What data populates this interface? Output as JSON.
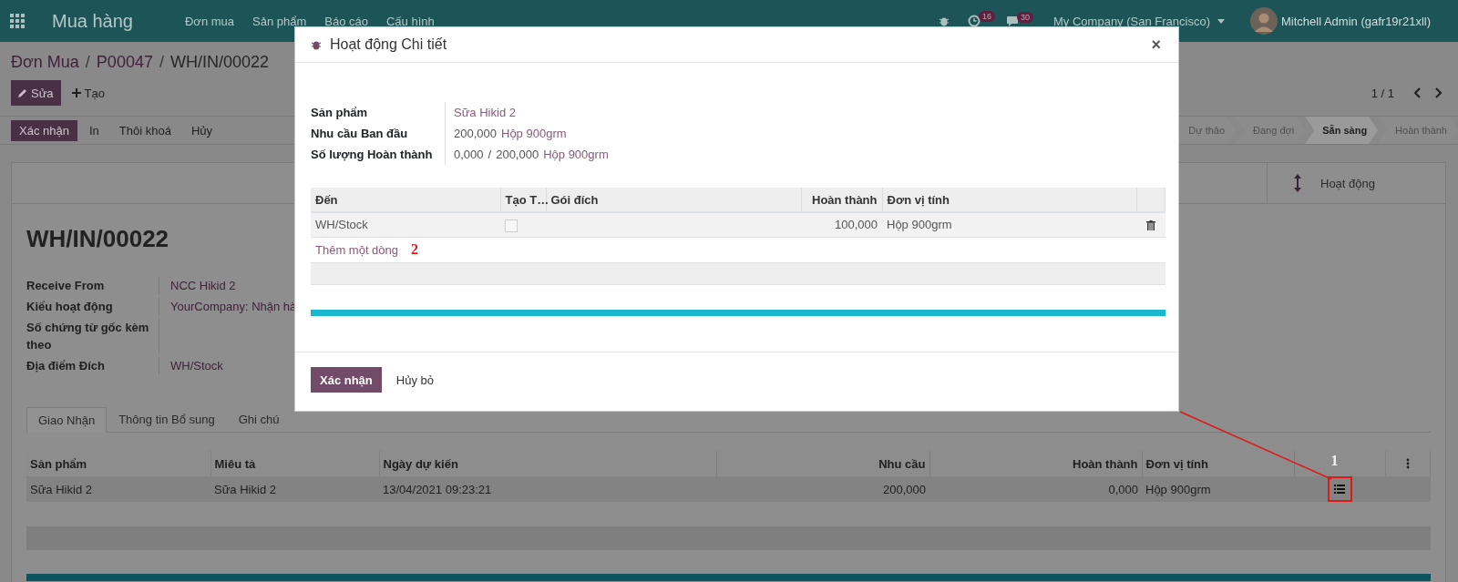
{
  "top_bar": {
    "app_title": "Mua hàng",
    "menu": [
      "Đơn mua",
      "Sản phẩm",
      "Báo cáo",
      "Cấu hình"
    ],
    "activity_count": "16",
    "message_count": "30",
    "company": "My Company (San Francisco)",
    "user": "Mitchell Admin (gafr19r21xll)"
  },
  "breadcrumbs": {
    "separator": "/",
    "items": [
      {
        "label": "Đơn Mua",
        "link": true
      },
      {
        "label": "P00047",
        "link": true
      },
      {
        "label": "WH/IN/00022",
        "link": false
      }
    ]
  },
  "actions": [
    {
      "label": "Sửa",
      "kind": "primary"
    },
    {
      "label": "Tạo",
      "kind": "plain"
    }
  ],
  "pager": "1 / 1",
  "workflow_buttons": [
    {
      "label": "Xác nhận",
      "kind": "primary"
    },
    {
      "label": "In",
      "kind": "plain"
    },
    {
      "label": "Thôi khoá",
      "kind": "plain"
    },
    {
      "label": "Hủy",
      "kind": "plain"
    }
  ],
  "status_steps": [
    {
      "label": "Dự thảo",
      "selected": false
    },
    {
      "label": "Đang đợi",
      "selected": false
    },
    {
      "label": "Sẵn sàng",
      "selected": true
    },
    {
      "label": "Hoàn thành",
      "selected": false
    }
  ],
  "smart_button": {
    "label": "Hoạt động"
  },
  "record": {
    "title": "WH/IN/00022",
    "fields": [
      {
        "label": "Receive From",
        "value": "NCC Hikid 2",
        "link": true
      },
      {
        "label": "Kiểu hoạt động",
        "value": "YourCompany: Nhận hà",
        "link": true
      },
      {
        "label": "Số chứng từ gốc kèm theo"
      },
      {
        "label": "Địa điểm Đích",
        "value": "WH/Stock",
        "link": true
      }
    ]
  },
  "tabs": [
    {
      "label": "Giao Nhận",
      "selected": true
    },
    {
      "label": "Thông tin Bổ sung",
      "selected": false
    },
    {
      "label": "Ghi chú",
      "selected": false
    }
  ],
  "moves_table": {
    "columns": [
      {
        "label": "Sản phẩm",
        "numeric": false
      },
      {
        "label": "Miêu tả",
        "numeric": false
      },
      {
        "label": "Ngày dự kiến",
        "numeric": false
      },
      {
        "label": "Nhu cầu",
        "numeric": true
      },
      {
        "label": "Hoàn thành",
        "numeric": true
      },
      {
        "label": "Đơn vị tính",
        "numeric": false
      }
    ],
    "marker": "1",
    "rows": [
      {
        "cells": [
          "Sữa Hikid 2",
          "Sữa Hikid 2",
          "13/04/2021 09:23:21",
          "200,000",
          "0,000",
          "Hộp 900grm"
        ],
        "icon_highlighted": true
      }
    ]
  },
  "dialog": {
    "title": "Hoạt động Chi tiết",
    "close": "×",
    "info": [
      {
        "label": "Sản phẩm",
        "parts": [
          {
            "text": "Sữa Hikid 2",
            "link": true
          }
        ]
      },
      {
        "label": "Nhu cầu Ban đầu",
        "parts": [
          {
            "text": "200,000",
            "link": false
          },
          {
            "text": "Hộp 900grm",
            "link": true
          }
        ]
      },
      {
        "label": "Số lượng Hoàn thành",
        "parts": [
          {
            "text": "0,000",
            "link": false
          },
          {
            "text": "/",
            "link": false
          },
          {
            "text": "200,000",
            "link": false
          },
          {
            "text": "Hộp 900grm",
            "link": true
          }
        ]
      }
    ],
    "table": {
      "columns": [
        {
          "label": "Đến",
          "numeric": false
        },
        {
          "label": "Tạo T…"
        },
        {
          "label": "Gói đích",
          "numeric": false
        },
        {
          "label": "Hoàn thành",
          "numeric": true
        },
        {
          "label": "Đơn vị tính",
          "numeric": false
        }
      ],
      "rows": [
        {
          "destination": "WH/Stock",
          "create_package": false,
          "done": "100,000",
          "unit": "Hộp 900grm"
        }
      ],
      "add_line": "Thêm một dòng",
      "marker": "2"
    },
    "buttons": [
      {
        "label": "Xác nhận",
        "kind": "primary"
      },
      {
        "label": "Hủy bỏ",
        "kind": "plain"
      }
    ]
  }
}
